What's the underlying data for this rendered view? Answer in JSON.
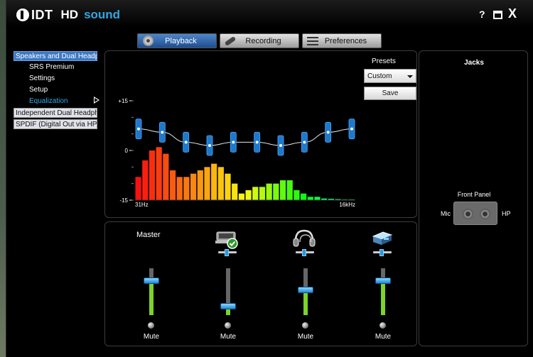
{
  "window": {
    "brand": "IDT",
    "title_hd": "HD",
    "title_sound": "sound",
    "help_label": "?",
    "close_label": "X"
  },
  "tabs": [
    {
      "label": "Playback",
      "icon": "disc-icon",
      "active": true
    },
    {
      "label": "Recording",
      "icon": "microphone-icon",
      "active": false
    },
    {
      "label": "Preferences",
      "icon": "preferences-icon",
      "active": false
    }
  ],
  "sidebar": {
    "items": [
      {
        "label": "Speakers and Dual Headphones",
        "type": "header",
        "selected": true
      },
      {
        "label": "SRS Premium",
        "type": "sub"
      },
      {
        "label": "Settings",
        "type": "sub"
      },
      {
        "label": "Setup",
        "type": "sub"
      },
      {
        "label": "Equalization",
        "type": "sub",
        "active": true
      },
      {
        "label": "Independent Dual Headphones",
        "type": "header"
      },
      {
        "label": "SPDIF (Digital Out via HP)",
        "type": "header"
      }
    ]
  },
  "presets": {
    "label": "Presets",
    "selected": "Custom",
    "save_label": "Save"
  },
  "equalizer": {
    "y_top_label": "+15",
    "y_mid_label": "0",
    "y_bottom_label": "-15",
    "x_start_label": "31Hz",
    "x_end_label": "16kHz",
    "band_gains_db": [
      6.5,
      5.5,
      2.5,
      1.5,
      2.5,
      2.5,
      1.5,
      2.5,
      5.5,
      6.5
    ],
    "spectrum_levels_db": [
      -8,
      -3,
      0,
      1,
      -1,
      -6,
      -8,
      -8,
      -7,
      -6,
      -5,
      -4,
      -5,
      -7,
      -10,
      -13,
      -12,
      -11,
      -11,
      -10,
      -10,
      -9,
      -9,
      -12,
      -13,
      -14,
      -14,
      -14.5,
      -14.6,
      -14.7,
      -14.8,
      -14.8
    ],
    "colors": {
      "band_handle": "#1f78c8",
      "curve": "#e8e8e8",
      "spectrum_low": "#ff2a10",
      "spectrum_mid": "#e0f018",
      "spectrum_high": "#20e8c8"
    }
  },
  "mixer": {
    "master_label": "Master",
    "channels": [
      {
        "name": "master",
        "icon": "",
        "volume": 0.75,
        "balance": 0.5,
        "mute_label": "Mute"
      },
      {
        "name": "speakers",
        "icon": "speaker-device-icon",
        "volume": 0.2,
        "balance": 0.5,
        "mute_label": "Mute"
      },
      {
        "name": "headphones",
        "icon": "headphones-icon",
        "volume": 0.55,
        "balance": 0.5,
        "mute_label": "Mute"
      },
      {
        "name": "spdif",
        "icon": "digital-out-icon",
        "volume": 0.75,
        "balance": 0.5,
        "mute_label": "Mute"
      }
    ],
    "accent": "#7cd32a"
  },
  "jacks": {
    "title": "Jacks",
    "front_panel_label": "Front Panel",
    "mic_label": "Mic",
    "hp_label": "HP"
  }
}
